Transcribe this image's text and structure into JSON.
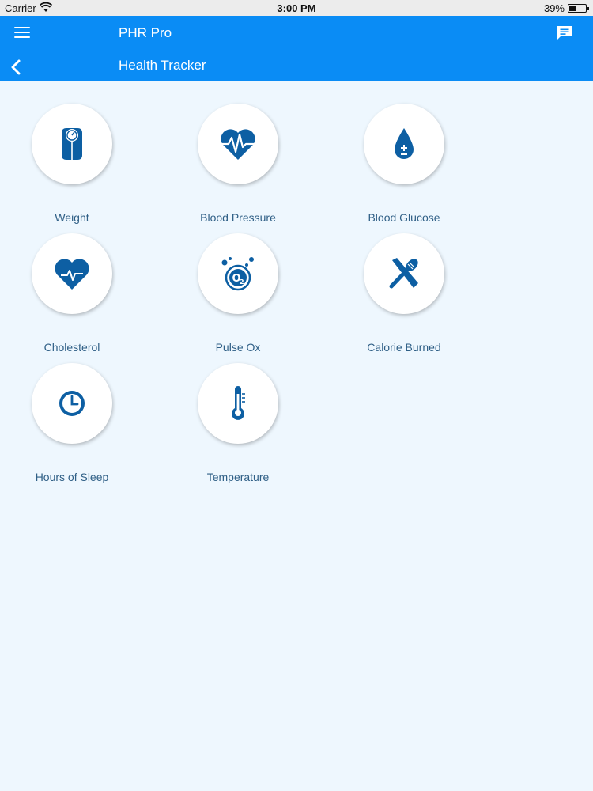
{
  "status_bar": {
    "carrier": "Carrier",
    "time": "3:00 PM",
    "battery": "39%",
    "battery_level": 0.39
  },
  "header": {
    "app_title": "PHR Pro",
    "page_title": "Health Tracker",
    "accent_color": "#0a8cf5",
    "icons": [
      "menu-icon",
      "chat-icon",
      "back-chevron-icon"
    ]
  },
  "trackers": [
    {
      "label": "Weight",
      "icon": "scale-icon"
    },
    {
      "label": "Blood Pressure",
      "icon": "heart-pulse-icon"
    },
    {
      "label": "Blood Glucose",
      "icon": "drop-icon"
    },
    {
      "label": "Cholesterol",
      "icon": "heart-icon"
    },
    {
      "label": "Pulse Ox",
      "icon": "o2-icon"
    },
    {
      "label": "Calorie Burned",
      "icon": "fork-knife-icon"
    },
    {
      "label": "Hours of Sleep",
      "icon": "clock-icon"
    },
    {
      "label": "Temperature",
      "icon": "thermometer-icon"
    }
  ],
  "colors": {
    "icon_color": "#0d5fa3",
    "label_color": "#2f5f86",
    "background": "#eef7fe"
  }
}
